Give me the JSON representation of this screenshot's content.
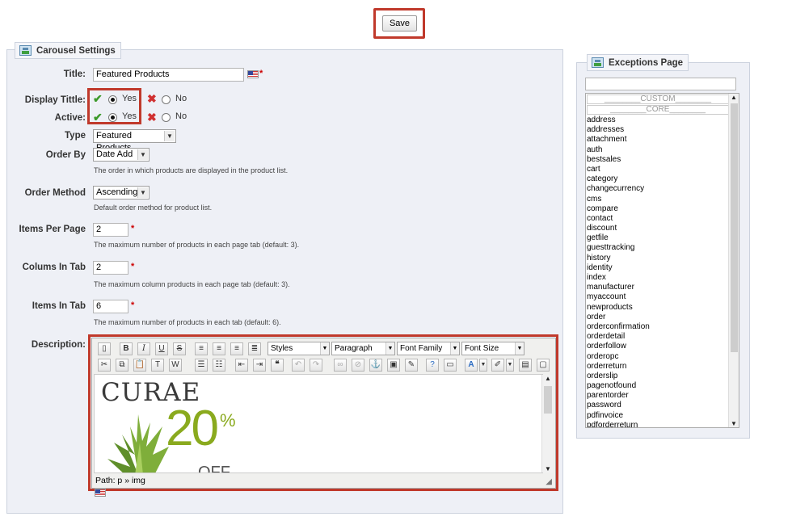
{
  "save_label": "Save",
  "carousel": {
    "legend": "Carousel Settings",
    "title": {
      "label": "Title:",
      "value": "Featured Products"
    },
    "display_title": {
      "label": "Display Tittle:",
      "yes": "Yes",
      "no": "No",
      "selected": "Yes"
    },
    "active": {
      "label": "Active:",
      "yes": "Yes",
      "no": "No",
      "selected": "Yes"
    },
    "type": {
      "label": "Type",
      "value": "Featured Products"
    },
    "order_by": {
      "label": "Order By",
      "value": "Date Add",
      "help": "The order in which products are displayed in the product list."
    },
    "order_method": {
      "label": "Order Method",
      "value": "Ascending",
      "help": "Default order method for product list."
    },
    "items_per_page": {
      "label": "Items Per Page",
      "value": "2",
      "help": "The maximum number of products in each page tab (default: 3)."
    },
    "colums_in_tab": {
      "label": "Colums In Tab",
      "value": "2",
      "help": "The maximum column products in each page tab (default: 3)."
    },
    "items_in_tab": {
      "label": "Items In Tab",
      "value": "6",
      "help": "The maximum number of products in each tab (default: 6)."
    },
    "description": {
      "label": "Description:",
      "toolbar": {
        "styles": "Styles",
        "format": "Paragraph",
        "font_family": "Font Family",
        "font_size": "Font Size"
      },
      "content_heading": "CURAE",
      "content_promo": "20",
      "content_percent": "%",
      "content_off": "OFF",
      "path": "Path: p » img"
    }
  },
  "exceptions": {
    "legend": "Exceptions Page",
    "filter_value": "",
    "header_custom": "CUSTOM",
    "header_core": "CORE",
    "pages": [
      "address",
      "addresses",
      "attachment",
      "auth",
      "bestsales",
      "cart",
      "category",
      "changecurrency",
      "cms",
      "compare",
      "contact",
      "discount",
      "getfile",
      "guesttracking",
      "history",
      "identity",
      "index",
      "manufacturer",
      "myaccount",
      "newproducts",
      "order",
      "orderconfirmation",
      "orderdetail",
      "orderfollow",
      "orderopc",
      "orderreturn",
      "orderslip",
      "pagenotfound",
      "parentorder",
      "password",
      "pdfinvoice",
      "pdforderreturn"
    ]
  }
}
